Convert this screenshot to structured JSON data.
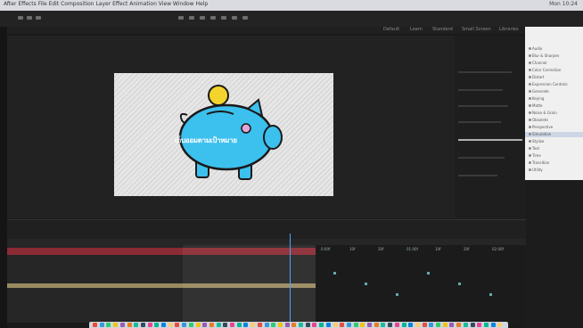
{
  "os_menubar": {
    "text": "After Effects  File  Edit  Composition  Layer  Effect  Animation  View  Window  Help",
    "status": "Mon 10:24"
  },
  "toolbar": {
    "labels": [
      "Default",
      "Learn",
      "Standard",
      "Small Screen",
      "Libraries"
    ]
  },
  "viewer": {
    "caption": "เก็บออมตามเป้าหมาย"
  },
  "effects_panel": {
    "items": [
      "Audio",
      "Blur & Sharpen",
      "Channel",
      "Color Correction",
      "Distort",
      "Expression Controls",
      "Generate",
      "Keying",
      "Matte",
      "Noise & Grain",
      "Obsolete",
      "Perspective",
      "Simulation",
      "Stylize",
      "Text",
      "Time",
      "Transition",
      "Utility"
    ]
  },
  "timeline": {
    "graph_labels": [
      "0:00f",
      "10f",
      "20f",
      "01:00f",
      "10f",
      "20f",
      "02:00f"
    ]
  },
  "colors": {
    "accent": "#4aa3ff",
    "piggy": "#3cc0ee",
    "coin": "#f4d32c",
    "track_red": "#8b2b35"
  },
  "icons": [
    "apple-icon",
    "piggy-bank-icon",
    "coin-icon",
    "search-icon",
    "playhead-icon"
  ]
}
